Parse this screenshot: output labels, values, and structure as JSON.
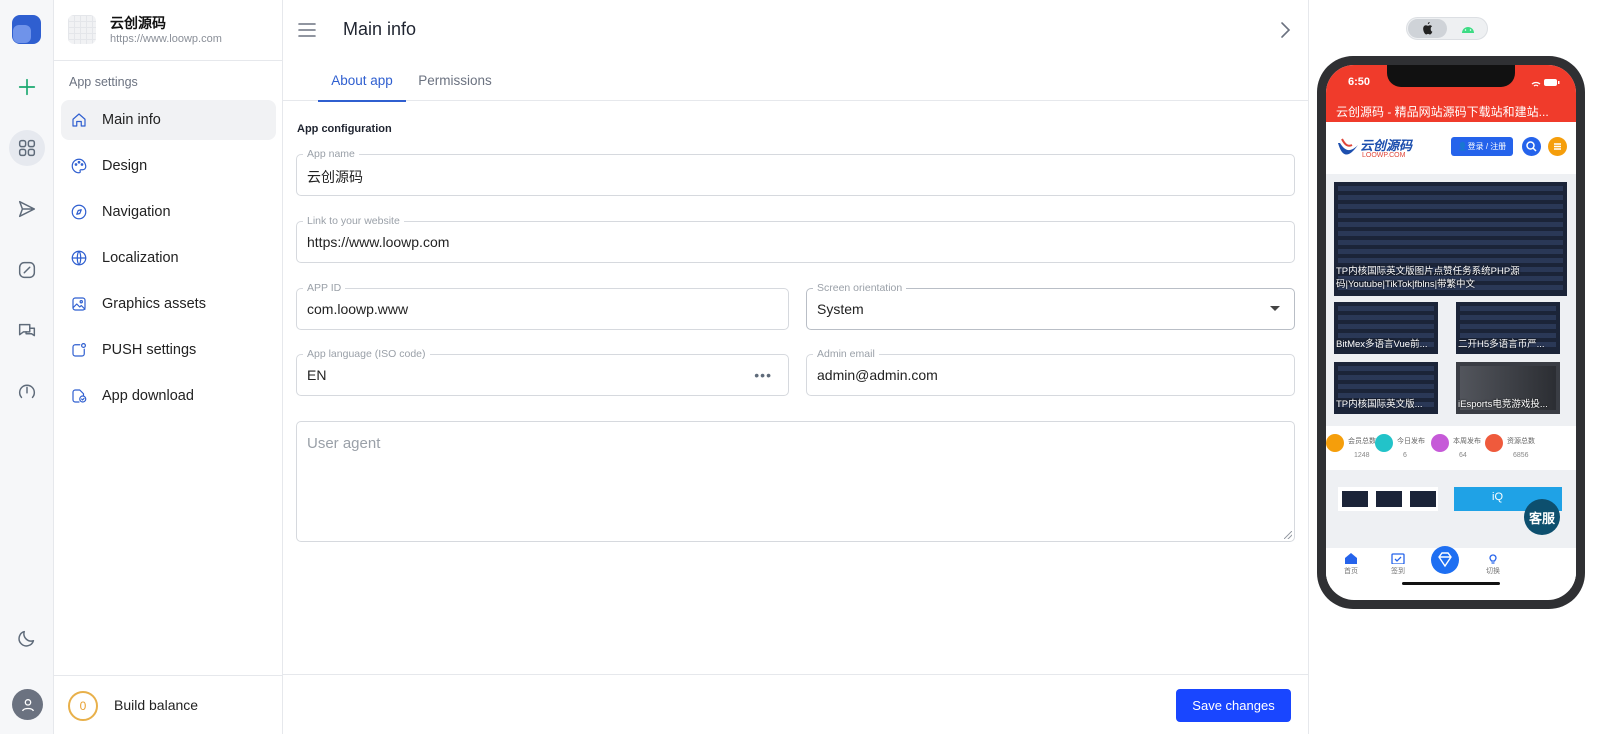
{
  "colors": {
    "accent": "#2f5fd0",
    "primary_button": "#1946ff",
    "phone_header": "#f03b2b",
    "balance_ring": "#e8b04a"
  },
  "rail": {
    "icons": [
      "app-logo-icon",
      "plus-icon",
      "grid-icon",
      "send-icon",
      "link-icon",
      "chat-icon",
      "gauge-icon",
      "moon-icon",
      "user-icon"
    ]
  },
  "app": {
    "name": "云创源码",
    "url": "https://www.loowp.com"
  },
  "sidebar": {
    "section_label": "App settings",
    "items": [
      {
        "label": "Main info",
        "icon": "home-icon"
      },
      {
        "label": "Design",
        "icon": "palette-icon"
      },
      {
        "label": "Navigation",
        "icon": "compass-icon"
      },
      {
        "label": "Localization",
        "icon": "globe-icon"
      },
      {
        "label": "Graphics assets",
        "icon": "image-icon"
      },
      {
        "label": "PUSH settings",
        "icon": "notification-icon"
      },
      {
        "label": "App download",
        "icon": "download-icon"
      }
    ],
    "balance": {
      "count": "0",
      "label": "Build balance"
    }
  },
  "header": {
    "title": "Main info"
  },
  "tabs": [
    {
      "label": "About app"
    },
    {
      "label": "Permissions"
    }
  ],
  "form": {
    "section_title": "App configuration",
    "app_name": {
      "label": "App name",
      "value": "云创源码"
    },
    "website": {
      "label": "Link to your website",
      "value": "https://www.loowp.com"
    },
    "app_id": {
      "label": "APP ID",
      "value": "com.loowp.www"
    },
    "orientation": {
      "label": "Screen orientation",
      "value": "System"
    },
    "language": {
      "label": "App language (ISO code)",
      "value": "EN",
      "more": "•••"
    },
    "admin_email": {
      "label": "Admin email",
      "value": "admin@admin.com"
    },
    "user_agent": {
      "placeholder": "User agent"
    }
  },
  "footer": {
    "save_label": "Save changes"
  },
  "preview": {
    "os_options": [
      "apple-icon",
      "android-icon"
    ],
    "status_time": "6:50",
    "page_title": "云创源码 - 精品网站源码下载站和建站...",
    "site_logo": {
      "name": "云创源码",
      "domain": "LOOWP.COM"
    },
    "login_label": "👤登录 / 注册",
    "cards": [
      "TP内核国际英文版图片点赞任务系统PHP源码|Youtube|TikTok|fblns|带繁中文",
      "BitMex多语言Vue前...",
      "二开H5多语言币严...",
      "TP内核国际英文版...",
      "iEsports电竞游戏投..."
    ],
    "stats": [
      {
        "label": "会员总数",
        "value": "1248"
      },
      {
        "label": "今日发布",
        "value": "6"
      },
      {
        "label": "本周发布",
        "value": "64"
      },
      {
        "label": "资源总数",
        "value": "6856"
      }
    ],
    "tabbar": [
      "首页",
      "签到",
      "",
      "切换",
      ""
    ],
    "kefu_label": "客服",
    "banner_text": "iQ"
  }
}
